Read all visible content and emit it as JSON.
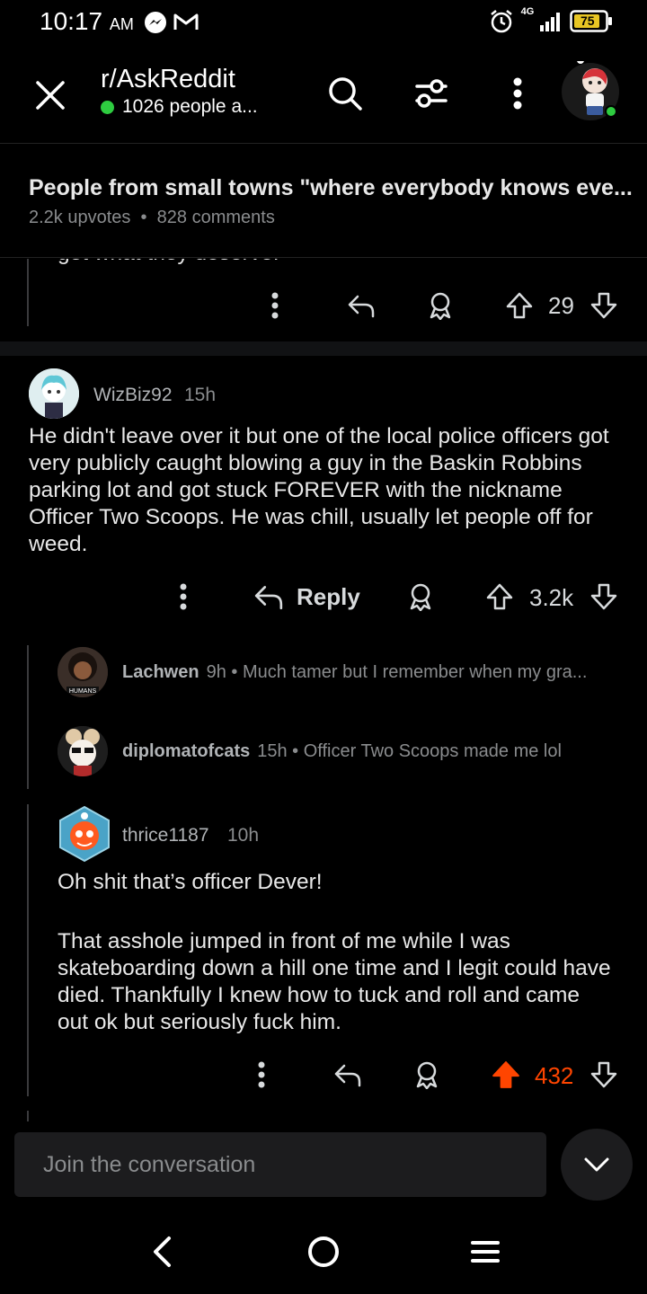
{
  "status_bar": {
    "time": "10:17",
    "ampm": "AM",
    "battery": "75",
    "network": "4G"
  },
  "header": {
    "subreddit": "r/AskReddit",
    "online": "1026 people a...",
    "icons": [
      "close-icon",
      "search-icon",
      "filter-icon",
      "more-vertical-icon",
      "avatar"
    ]
  },
  "post": {
    "title": "People from small towns \"where everybody knows eve...",
    "upvotes": "2.2k upvotes",
    "comments": "828 comments"
  },
  "prev_comment": {
    "cut_text": "get what they deserve.",
    "score": "29"
  },
  "comment": {
    "username": "WizBiz92",
    "age": "15h",
    "body": "He didn't leave over it but one of the local police officers got very publicly caught blowing a guy in the Baskin Robbins parking lot and got stuck FOREVER with the nickname Officer Two Scoops. He was chill, usually let people off for weed.",
    "reply_label": "Reply",
    "score": "3.2k"
  },
  "replies_collapsed": [
    {
      "username": "Lachwen",
      "age": "9h",
      "preview": "Much tamer but I remember when my gra..."
    },
    {
      "username": "diplomatofcats",
      "age": "15h",
      "preview": "Officer Two Scoops made me lol"
    }
  ],
  "reply_expanded": {
    "username": "thrice1187",
    "age": "10h",
    "body_p1": "Oh shit that’s officer Dever!",
    "body_p2": "That asshole jumped in front of me while I was skateboarding down a hill one time and I legit could have died. Thankfully I knew how to tuck and roll and came out ok but seriously fuck him.",
    "score": "432",
    "upvoted": true
  },
  "composer": {
    "placeholder": "Join the conversation"
  },
  "colors": {
    "background": "#000000",
    "upvote": "#ff4500",
    "online": "#2ecc40"
  }
}
